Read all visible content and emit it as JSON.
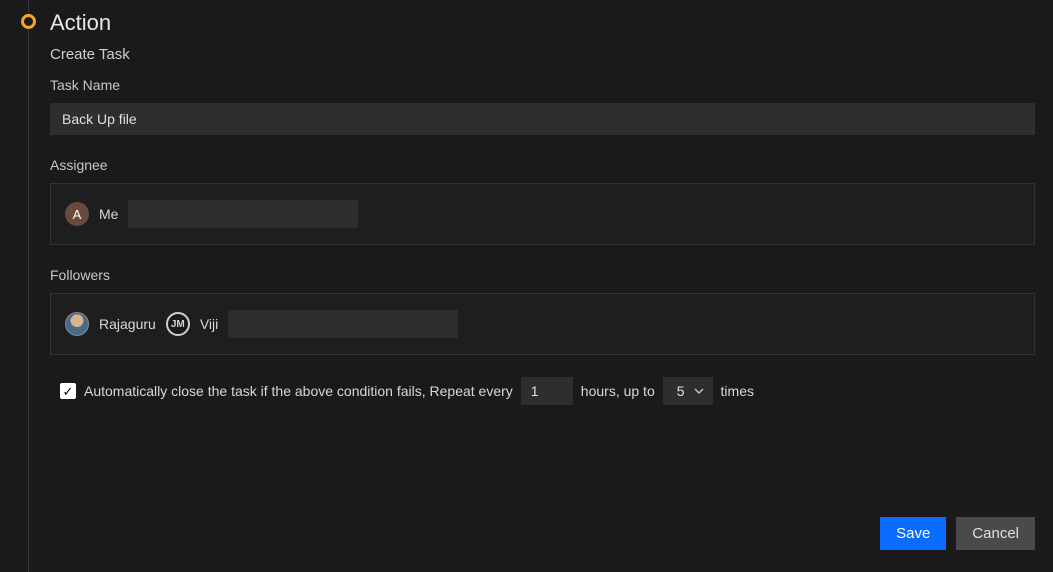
{
  "section": {
    "title": "Action",
    "subtitle": "Create Task"
  },
  "fields": {
    "task_name_label": "Task Name",
    "task_name_value": "Back Up file",
    "assignee_label": "Assignee",
    "followers_label": "Followers"
  },
  "assignee": {
    "avatar_letter": "A",
    "name": "Me"
  },
  "followers": [
    {
      "name": "Rajaguru",
      "avatar_type": "photo"
    },
    {
      "name": "Viji",
      "avatar_type": "initials",
      "initials": "JM"
    }
  ],
  "repeat": {
    "checked": true,
    "text_before": "Automatically close the task if the above condition fails, Repeat every",
    "hours_value": "1",
    "text_mid": "hours, up to",
    "count_value": "5",
    "text_after": "times"
  },
  "buttons": {
    "save": "Save",
    "cancel": "Cancel"
  }
}
